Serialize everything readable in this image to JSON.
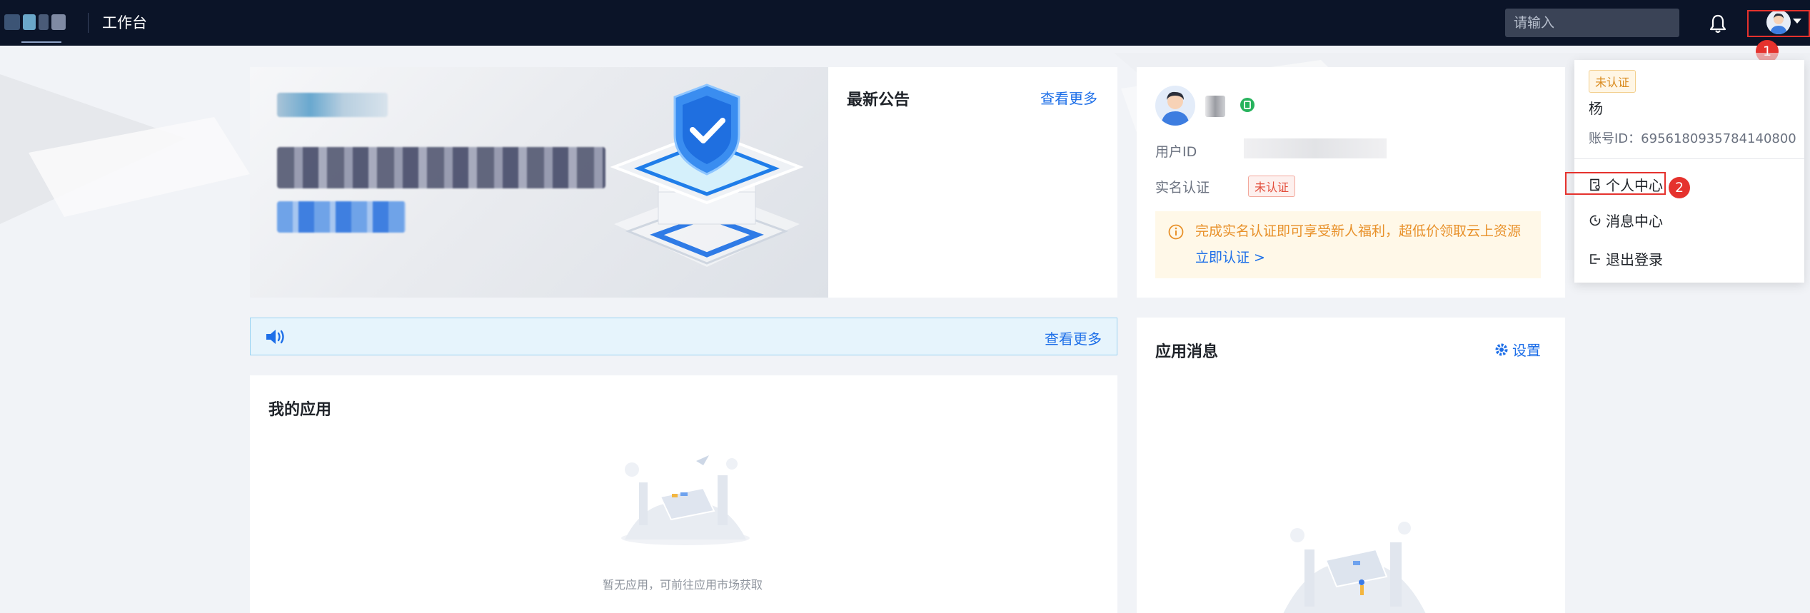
{
  "header": {
    "app_name": "工作台",
    "search_placeholder": "请输入"
  },
  "banner": {},
  "notice": {
    "title": "最新公告",
    "more": "查看更多"
  },
  "user": {
    "id_label": "用户ID",
    "realname_label": "实名认证",
    "realname_status": "未认证",
    "tip_text": "完成实名认证即可享受新人福利，超低价领取云上资源",
    "tip_link": "立即认证 >"
  },
  "announcement_bar": {
    "more": "查看更多"
  },
  "apps": {
    "title": "我的应用",
    "empty": "暂无应用，可前往应用市场获取"
  },
  "messages": {
    "title": "应用消息",
    "settings": "设置"
  },
  "dropdown": {
    "status_tag": "未认证",
    "name": "杨",
    "account_label": "账号ID：6956180935784140800",
    "items": [
      {
        "label": "个人中心"
      },
      {
        "label": "消息中心"
      },
      {
        "label": "退出登录"
      }
    ]
  },
  "annotations": {
    "step1": "1",
    "step2": "2"
  },
  "colors": {
    "topbar": "#0b1428",
    "accent": "#1e6fe8",
    "highlight": "#e5322d",
    "warning": "#e8912a"
  }
}
